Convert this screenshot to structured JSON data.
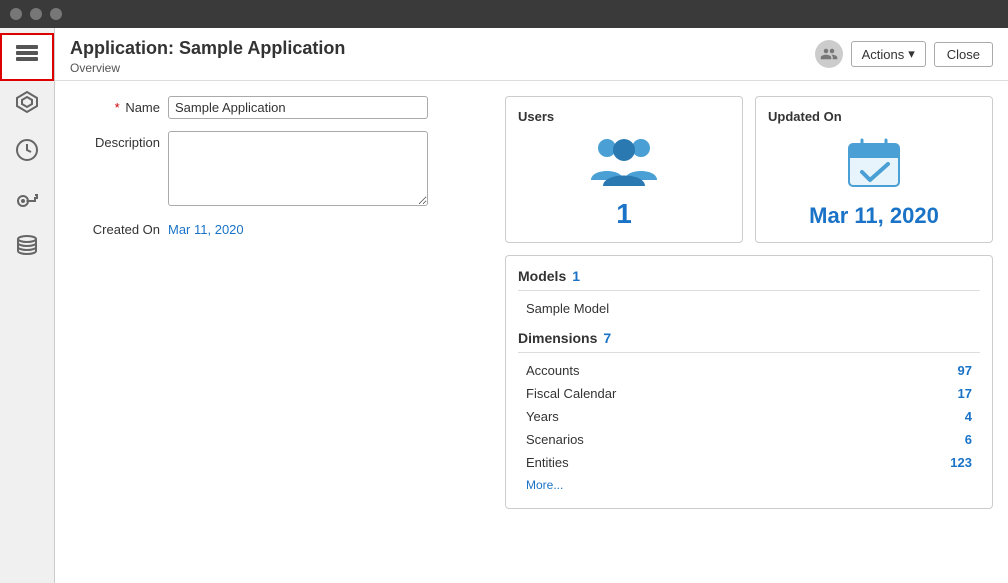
{
  "topbar": {
    "dots": 3
  },
  "header": {
    "title": "Application: Sample Application",
    "subtitle": "Overview",
    "actions_label": "Actions",
    "actions_chevron": "▾",
    "close_label": "Close"
  },
  "form": {
    "name_label": "Name",
    "name_required": "*",
    "name_value": "Sample Application",
    "description_label": "Description",
    "description_placeholder": "",
    "created_on_label": "Created On",
    "created_on_value": "Mar 11, 2020"
  },
  "users_card": {
    "title": "Users",
    "count": "1"
  },
  "updated_card": {
    "title": "Updated On",
    "date": "Mar 11, 2020"
  },
  "models_section": {
    "label": "Models",
    "count": "1",
    "items": [
      "Sample Model"
    ]
  },
  "dimensions_section": {
    "label": "Dimensions",
    "count": "7",
    "items": [
      {
        "name": "Accounts",
        "count": "97"
      },
      {
        "name": "Fiscal Calendar",
        "count": "17"
      },
      {
        "name": "Years",
        "count": "4"
      },
      {
        "name": "Scenarios",
        "count": "6"
      },
      {
        "name": "Entities",
        "count": "123"
      }
    ],
    "more_label": "More..."
  },
  "sidebar": {
    "items": [
      {
        "icon": "☰",
        "label": "overview",
        "active": true
      },
      {
        "icon": "◈",
        "label": "models",
        "active": false
      },
      {
        "icon": "⌚",
        "label": "time",
        "active": false
      },
      {
        "icon": "🔑",
        "label": "access",
        "active": false
      },
      {
        "icon": "🗄",
        "label": "database",
        "active": false
      }
    ]
  }
}
